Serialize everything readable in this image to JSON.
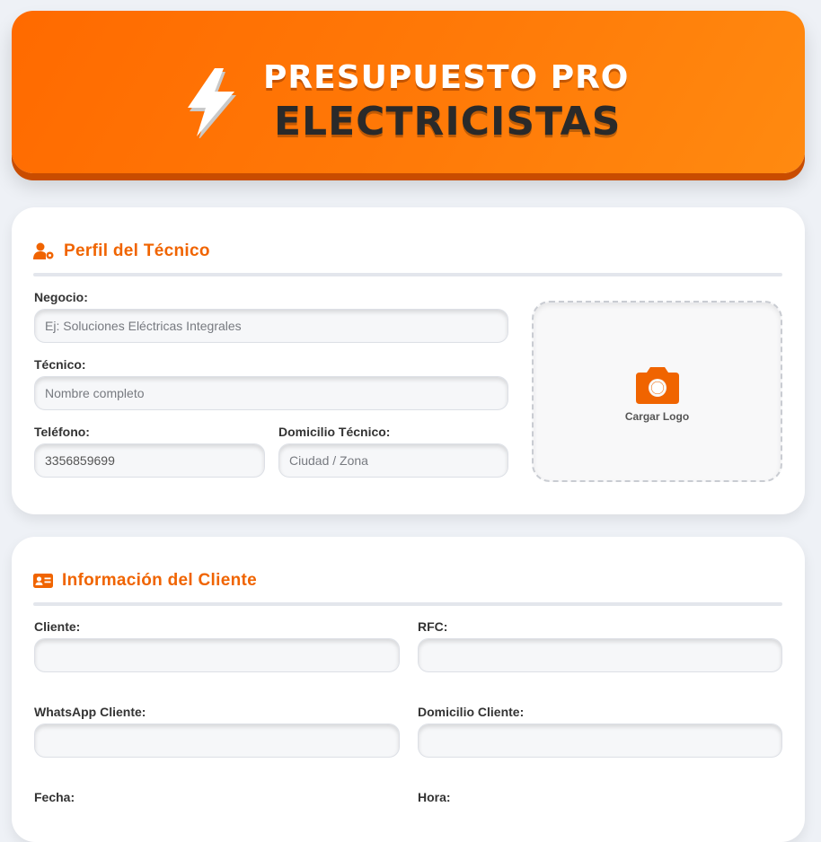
{
  "header": {
    "title_line1": "PRESUPUESTO PRO",
    "title_line2": "ELECTRICISTAS"
  },
  "profile": {
    "section_title": "Perfil del Técnico",
    "negocio_label": "Negocio:",
    "negocio_placeholder": "Ej: Soluciones Eléctricas Integrales",
    "tecnico_label": "Técnico:",
    "tecnico_placeholder": "Nombre completo",
    "telefono_label": "Teléfono:",
    "telefono_value": "3356859699",
    "domicilio_label": "Domicilio Técnico:",
    "domicilio_placeholder": "Ciudad / Zona",
    "logo_label": "Cargar Logo"
  },
  "client": {
    "section_title": "Información del Cliente",
    "cliente_label": "Cliente:",
    "rfc_label": "RFC:",
    "whatsapp_label": "WhatsApp Cliente:",
    "domicilio_label": "Domicilio Cliente:",
    "fecha_label": "Fecha:",
    "hora_label": "Hora:"
  },
  "colors": {
    "accent": "#f06400",
    "header_gradient_start": "#ff6a00",
    "header_gradient_end": "#ff8a10"
  }
}
